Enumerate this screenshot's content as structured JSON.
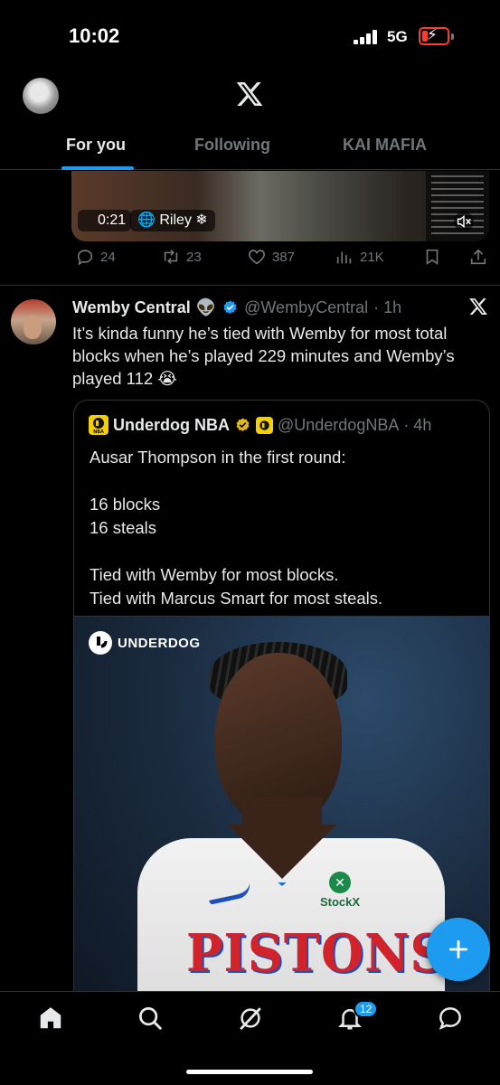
{
  "status_bar": {
    "time": "10:02",
    "network": "5G"
  },
  "header": {
    "tabs": [
      {
        "label": "For you",
        "active": true
      },
      {
        "label": "Following",
        "active": false
      },
      {
        "label": "KAI MAFIA",
        "active": false
      }
    ]
  },
  "prev_tweet": {
    "video_time": "0:21",
    "video_tag": "Riley",
    "actions": {
      "replies": "24",
      "retweets": "23",
      "likes": "387",
      "views": "21K"
    }
  },
  "tweet": {
    "author": "Wemby Central",
    "emoji": "👽",
    "handle": "@WembyCentral",
    "time": "· 1h",
    "text": "It’s kinda funny he’s tied with Wemby for most total blocks when he’s played 229 minutes and Wemby’s played 112 😭"
  },
  "quote": {
    "author": "Underdog NBA",
    "handle": "@UnderdogNBA",
    "time": "· 4h",
    "body": "Ausar Thompson in the first round:\n\n16 blocks\n16 steals\n\nTied with Wemby for most blocks.\nTied with Marcus Smart for most steals.",
    "image": {
      "brand": "UNDERDOG",
      "jersey_text": "PISTONS",
      "sponsor": "StockX"
    }
  },
  "nav": {
    "notifications_badge": "12"
  },
  "colors": {
    "accent": "#1d9bf0",
    "muted": "#71767b",
    "text": "#e7e9ea"
  }
}
